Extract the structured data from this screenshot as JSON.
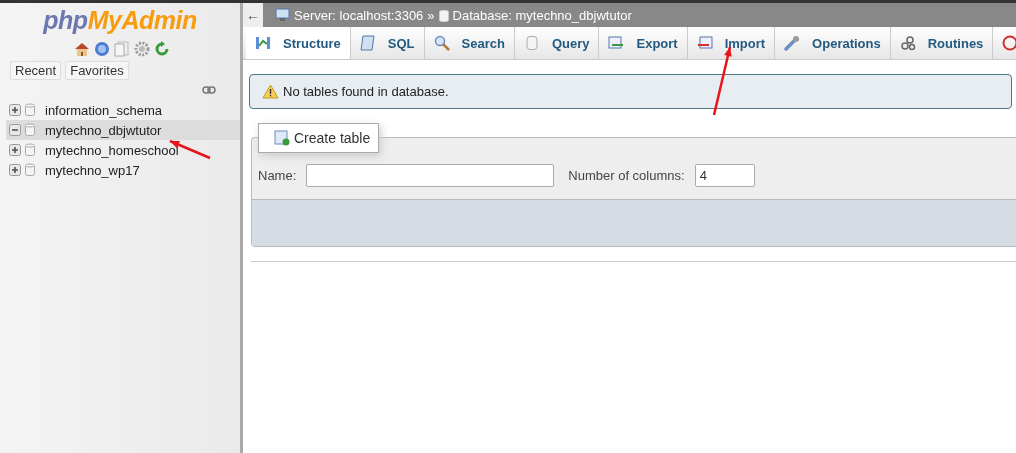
{
  "sidebar": {
    "logo": {
      "part_1": "php",
      "part_2": "MyAdmin"
    },
    "tabs": [
      {
        "label": "Recent"
      },
      {
        "label": "Favorites"
      }
    ],
    "databases": [
      {
        "name": "information_schema",
        "expanded": false,
        "selected": false
      },
      {
        "name": "mytechno_dbjwtutor",
        "expanded": true,
        "selected": true
      },
      {
        "name": "mytechno_homeschool",
        "expanded": false,
        "selected": false
      },
      {
        "name": "mytechno_wp17",
        "expanded": false,
        "selected": false
      }
    ]
  },
  "breadcrumb": {
    "back": "←",
    "server": "Server: localhost:3306",
    "separator": "»",
    "database": "Database: mytechno_dbjwtutor"
  },
  "tabs": [
    {
      "label": "Structure",
      "selected": true
    },
    {
      "label": "SQL",
      "selected": false
    },
    {
      "label": "Search",
      "selected": false
    },
    {
      "label": "Query",
      "selected": false
    },
    {
      "label": "Export",
      "selected": false
    },
    {
      "label": "Import",
      "selected": false
    },
    {
      "label": "Operations",
      "selected": false
    },
    {
      "label": "Routines",
      "selected": false
    }
  ],
  "notice": "No tables found in database.",
  "create_table": {
    "legend": "Create table",
    "name_label": "Name:",
    "columns_label": "Number of columns:",
    "columns_value": "4"
  }
}
